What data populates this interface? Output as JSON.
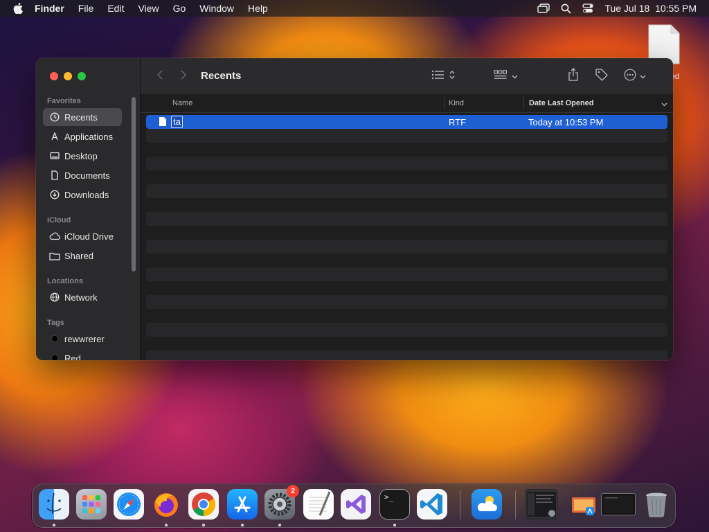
{
  "menubar": {
    "app_name": "Finder",
    "items": [
      "File",
      "Edit",
      "View",
      "Go",
      "Window",
      "Help"
    ],
    "clock": "Tue Jul 18  10:55 PM",
    "status_icons": [
      "screen-mirroring-icon",
      "spotlight-search-icon",
      "control-center-icon"
    ]
  },
  "desktop": {
    "file_label_partial": "ed"
  },
  "finder": {
    "title": "Recents",
    "sidebar": {
      "favorites_header": "Favorites",
      "favorites": [
        {
          "label": "Recents",
          "icon": "clock-icon",
          "active": true
        },
        {
          "label": "Applications",
          "icon": "applications-icon"
        },
        {
          "label": "Desktop",
          "icon": "desktop-icon"
        },
        {
          "label": "Documents",
          "icon": "document-icon"
        },
        {
          "label": "Downloads",
          "icon": "download-icon"
        }
      ],
      "icloud_header": "iCloud",
      "icloud": [
        {
          "label": "iCloud Drive",
          "icon": "cloud-icon"
        },
        {
          "label": "Shared",
          "icon": "shared-folder-icon"
        }
      ],
      "locations_header": "Locations",
      "locations": [
        {
          "label": "Network",
          "icon": "globe-icon"
        }
      ],
      "tags_header": "Tags",
      "tags": [
        {
          "label": "rewwrerer",
          "color": "#000000"
        },
        {
          "label": "Red",
          "color": "#000000"
        }
      ]
    },
    "columns": {
      "name": "Name",
      "kind": "Kind",
      "date": "Date Last Opened"
    },
    "files": [
      {
        "name": "ta",
        "kind": "RTF",
        "date": "Today at 10:53 PM",
        "selected": true,
        "renaming": true
      }
    ]
  },
  "dock": {
    "apps": [
      "Finder",
      "Launchpad",
      "Safari",
      "Firefox",
      "Google Chrome",
      "App Store",
      "System Settings",
      "TextEdit",
      "Visual Studio",
      "Terminal",
      "Visual Studio Code",
      "Weather"
    ],
    "settings_badge": "2",
    "accent_selection": "#1f5fd4"
  }
}
